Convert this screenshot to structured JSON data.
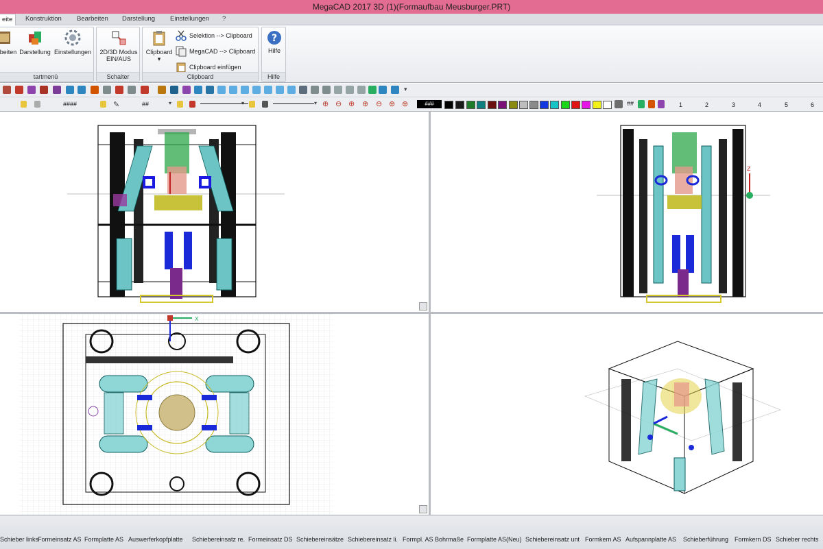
{
  "window": {
    "title": "MegaCAD 2017 3D (1)(Formaufbau Meusburger.PRT)"
  },
  "tabs": [
    {
      "label": "eite",
      "active": true
    },
    {
      "label": "Konstruktion"
    },
    {
      "label": "Bearbeiten"
    },
    {
      "label": "Darstellung"
    },
    {
      "label": "Einstellungen"
    },
    {
      "label": "?"
    }
  ],
  "ribbon": {
    "startmenu": {
      "group_label": "tartmenü",
      "buttons": [
        "beiten",
        "Darstellung",
        "Einstellungen"
      ]
    },
    "schalter": {
      "group_label": "Schalter",
      "button_line1": "2D/3D Modus",
      "button_line2": "EIN/AUS"
    },
    "clipboard": {
      "group_label": "Clipboard",
      "big_button": "Clipboard",
      "sel_to_clip": "Selektion --> Clipboard",
      "mega_to_clip": "MegaCAD --> Clipboard",
      "clip_insert": "Clipboard einfügen"
    },
    "hilfe": {
      "group_label": "Hilfe",
      "button": "Hilfe"
    }
  },
  "toolbar2": {
    "pattern_a": "####",
    "pattern_b": "##",
    "colorbox_label": "###",
    "grid_label": "##",
    "layer_numbers": [
      "1",
      "2",
      "3",
      "4",
      "5",
      "6"
    ],
    "swatch_colors": [
      "#000000",
      "#1a1a1a",
      "#1f7a2a",
      "#0f7f7f",
      "#6b0f0f",
      "#7a0f7a",
      "#8a8a10",
      "#bdbdbd",
      "#8a8a8a",
      "#1437e0",
      "#16c6c6",
      "#19d619",
      "#e01414",
      "#e614e6",
      "#f2f21a",
      "#ffffff"
    ]
  },
  "viewports": {
    "axis_x": "X",
    "axis_z": "Z"
  },
  "layers": [
    "Schieber links",
    "Formeinsatz AS",
    "Formplatte AS",
    "Auswerferkopfplatte",
    "Schiebereinsatz re.",
    "Formeinsatz DS",
    "Schiebereinsätze",
    "Schiebereinsatz li.",
    "Formpl. AS Bohrmaße",
    "Formplatte AS(Neu)",
    "Schiebereinsatz unt",
    "Formkern AS",
    "Aufspannplatte AS",
    "Schieberführung",
    "Formkern DS",
    "Schieber rechts"
  ]
}
